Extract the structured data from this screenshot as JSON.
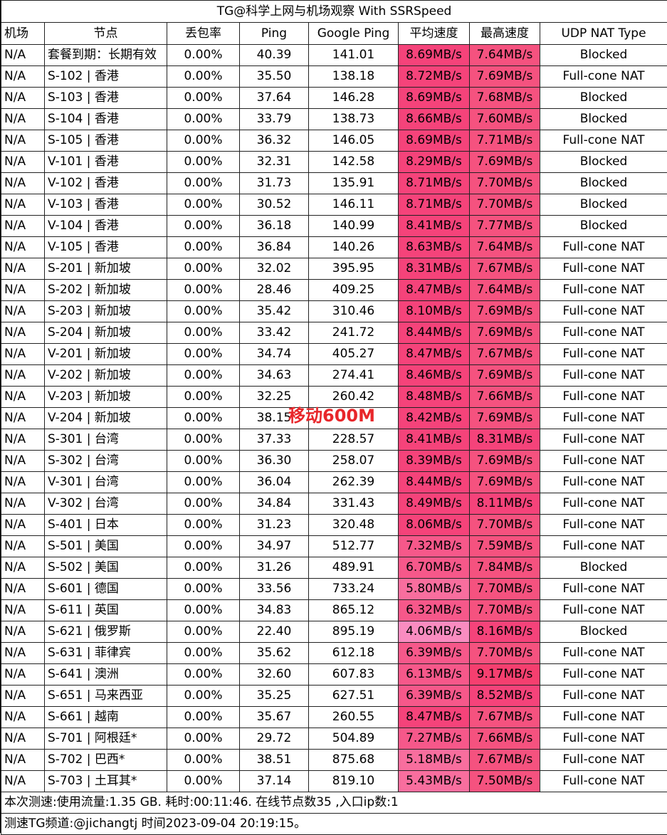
{
  "title": "TG@科学上网与机场观察 With SSRSpeed",
  "headers": [
    "机场",
    "节点",
    "丢包率",
    "Ping",
    "Google Ping",
    "平均速度",
    "最高速度",
    "UDP NAT Type"
  ],
  "colors": {
    "avg_speed_strong": "#f5437a",
    "avg_speed_mid": "#f6588a",
    "avg_speed_light": "#f98cc0",
    "max_speed_strong": "#f5437a",
    "max_speed_normal": "#f5527f",
    "border": "#222222",
    "watermark": "#e8262a"
  },
  "rows": [
    {
      "airport": "N/A",
      "node": "套餐到期：长期有效",
      "loss": "0.00%",
      "ping": "40.39",
      "gping": "141.01",
      "avg": "8.69MB/s",
      "max": "7.64MB/s",
      "nat": "Blocked",
      "avg_c": "#f5437a",
      "max_c": "#f5527f"
    },
    {
      "airport": "N/A",
      "node": "S-102 | 香港",
      "loss": "0.00%",
      "ping": "35.50",
      "gping": "138.18",
      "avg": "8.72MB/s",
      "max": "7.69MB/s",
      "nat": "Full-cone NAT",
      "avg_c": "#f5437a",
      "max_c": "#f5527f"
    },
    {
      "airport": "N/A",
      "node": "S-103 | 香港",
      "loss": "0.00%",
      "ping": "37.64",
      "gping": "146.28",
      "avg": "8.69MB/s",
      "max": "7.68MB/s",
      "nat": "Blocked",
      "avg_c": "#f5437a",
      "max_c": "#f5527f"
    },
    {
      "airport": "N/A",
      "node": "S-104 | 香港",
      "loss": "0.00%",
      "ping": "33.79",
      "gping": "138.73",
      "avg": "8.66MB/s",
      "max": "7.60MB/s",
      "nat": "Blocked",
      "avg_c": "#f5437a",
      "max_c": "#f5527f"
    },
    {
      "airport": "N/A",
      "node": "S-105 | 香港",
      "loss": "0.00%",
      "ping": "36.32",
      "gping": "146.05",
      "avg": "8.69MB/s",
      "max": "7.71MB/s",
      "nat": "Full-cone NAT",
      "avg_c": "#f5437a",
      "max_c": "#f5527f"
    },
    {
      "airport": "N/A",
      "node": "V-101 | 香港",
      "loss": "0.00%",
      "ping": "32.31",
      "gping": "142.58",
      "avg": "8.29MB/s",
      "max": "7.69MB/s",
      "nat": "Blocked",
      "avg_c": "#f5437a",
      "max_c": "#f5527f"
    },
    {
      "airport": "N/A",
      "node": "V-102 | 香港",
      "loss": "0.00%",
      "ping": "31.73",
      "gping": "135.91",
      "avg": "8.71MB/s",
      "max": "7.70MB/s",
      "nat": "Blocked",
      "avg_c": "#f5437a",
      "max_c": "#f5527f"
    },
    {
      "airport": "N/A",
      "node": "V-103 | 香港",
      "loss": "0.00%",
      "ping": "30.52",
      "gping": "146.11",
      "avg": "8.71MB/s",
      "max": "7.70MB/s",
      "nat": "Blocked",
      "avg_c": "#f5437a",
      "max_c": "#f5527f"
    },
    {
      "airport": "N/A",
      "node": "V-104 | 香港",
      "loss": "0.00%",
      "ping": "36.18",
      "gping": "140.99",
      "avg": "8.41MB/s",
      "max": "7.77MB/s",
      "nat": "Blocked",
      "avg_c": "#f5437a",
      "max_c": "#f5527f"
    },
    {
      "airport": "N/A",
      "node": "V-105 | 香港",
      "loss": "0.00%",
      "ping": "36.84",
      "gping": "140.26",
      "avg": "8.63MB/s",
      "max": "7.64MB/s",
      "nat": "Full-cone NAT",
      "avg_c": "#f5437a",
      "max_c": "#f5527f"
    },
    {
      "airport": "N/A",
      "node": "S-201 | 新加坡",
      "loss": "0.00%",
      "ping": "32.02",
      "gping": "395.95",
      "avg": "8.31MB/s",
      "max": "7.67MB/s",
      "nat": "Full-cone NAT",
      "avg_c": "#f5437a",
      "max_c": "#f5527f"
    },
    {
      "airport": "N/A",
      "node": "S-202 | 新加坡",
      "loss": "0.00%",
      "ping": "28.46",
      "gping": "409.25",
      "avg": "8.47MB/s",
      "max": "7.64MB/s",
      "nat": "Full-cone NAT",
      "avg_c": "#f5437a",
      "max_c": "#f5527f"
    },
    {
      "airport": "N/A",
      "node": "S-203 | 新加坡",
      "loss": "0.00%",
      "ping": "35.42",
      "gping": "310.46",
      "avg": "8.10MB/s",
      "max": "7.69MB/s",
      "nat": "Full-cone NAT",
      "avg_c": "#f5437a",
      "max_c": "#f5527f"
    },
    {
      "airport": "N/A",
      "node": "S-204 | 新加坡",
      "loss": "0.00%",
      "ping": "33.42",
      "gping": "241.72",
      "avg": "8.44MB/s",
      "max": "7.69MB/s",
      "nat": "Full-cone NAT",
      "avg_c": "#f5437a",
      "max_c": "#f5527f"
    },
    {
      "airport": "N/A",
      "node": "V-201 | 新加坡",
      "loss": "0.00%",
      "ping": "34.74",
      "gping": "405.27",
      "avg": "8.47MB/s",
      "max": "7.67MB/s",
      "nat": "Full-cone NAT",
      "avg_c": "#f5437a",
      "max_c": "#f5527f"
    },
    {
      "airport": "N/A",
      "node": "V-202 | 新加坡",
      "loss": "0.00%",
      "ping": "34.63",
      "gping": "274.41",
      "avg": "8.46MB/s",
      "max": "7.69MB/s",
      "nat": "Full-cone NAT",
      "avg_c": "#f5437a",
      "max_c": "#f5527f"
    },
    {
      "airport": "N/A",
      "node": "V-203 | 新加坡",
      "loss": "0.00%",
      "ping": "32.25",
      "gping": "260.42",
      "avg": "8.48MB/s",
      "max": "7.66MB/s",
      "nat": "Full-cone NAT",
      "avg_c": "#f5437a",
      "max_c": "#f5527f"
    },
    {
      "airport": "N/A",
      "node": "V-204 | 新加坡",
      "loss": "0.00%",
      "ping": "38.15",
      "gping": "",
      "avg": "8.42MB/s",
      "max": "7.69MB/s",
      "nat": "Full-cone NAT",
      "avg_c": "#f5437a",
      "max_c": "#f5527f"
    },
    {
      "airport": "N/A",
      "node": "S-301 | 台湾",
      "loss": "0.00%",
      "ping": "37.33",
      "gping": "228.57",
      "avg": "8.41MB/s",
      "max": "8.31MB/s",
      "nat": "Full-cone NAT",
      "avg_c": "#f5437a",
      "max_c": "#f5437a"
    },
    {
      "airport": "N/A",
      "node": "S-302 | 台湾",
      "loss": "0.00%",
      "ping": "36.30",
      "gping": "258.07",
      "avg": "8.39MB/s",
      "max": "7.69MB/s",
      "nat": "Full-cone NAT",
      "avg_c": "#f5437a",
      "max_c": "#f5527f"
    },
    {
      "airport": "N/A",
      "node": "V-301 | 台湾",
      "loss": "0.00%",
      "ping": "36.04",
      "gping": "262.39",
      "avg": "8.44MB/s",
      "max": "7.69MB/s",
      "nat": "Full-cone NAT",
      "avg_c": "#f5437a",
      "max_c": "#f5527f"
    },
    {
      "airport": "N/A",
      "node": "V-302 | 台湾",
      "loss": "0.00%",
      "ping": "34.84",
      "gping": "331.43",
      "avg": "8.49MB/s",
      "max": "8.11MB/s",
      "nat": "Full-cone NAT",
      "avg_c": "#f5437a",
      "max_c": "#f5437a"
    },
    {
      "airport": "N/A",
      "node": "S-401 | 日本",
      "loss": "0.00%",
      "ping": "31.23",
      "gping": "320.48",
      "avg": "8.06MB/s",
      "max": "7.70MB/s",
      "nat": "Full-cone NAT",
      "avg_c": "#f5437a",
      "max_c": "#f5527f"
    },
    {
      "airport": "N/A",
      "node": "S-501 | 美国",
      "loss": "0.00%",
      "ping": "34.97",
      "gping": "512.77",
      "avg": "7.32MB/s",
      "max": "7.59MB/s",
      "nat": "Full-cone NAT",
      "avg_c": "#f6588a",
      "max_c": "#f5527f"
    },
    {
      "airport": "N/A",
      "node": "S-502 | 美国",
      "loss": "0.00%",
      "ping": "31.26",
      "gping": "489.91",
      "avg": "6.70MB/s",
      "max": "7.84MB/s",
      "nat": "Blocked",
      "avg_c": "#f6588a",
      "max_c": "#f5527f"
    },
    {
      "airport": "N/A",
      "node": "S-601 | 德国",
      "loss": "0.00%",
      "ping": "33.56",
      "gping": "733.24",
      "avg": "5.80MB/s",
      "max": "7.70MB/s",
      "nat": "Full-cone NAT",
      "avg_c": "#f86e9e",
      "max_c": "#f5527f"
    },
    {
      "airport": "N/A",
      "node": "S-611 | 英国",
      "loss": "0.00%",
      "ping": "34.83",
      "gping": "865.12",
      "avg": "6.32MB/s",
      "max": "7.70MB/s",
      "nat": "Full-cone NAT",
      "avg_c": "#f6588a",
      "max_c": "#f5527f"
    },
    {
      "airport": "N/A",
      "node": "S-621 | 俄罗斯",
      "loss": "0.00%",
      "ping": "22.40",
      "gping": "895.19",
      "avg": "4.06MB/s",
      "max": "8.16MB/s",
      "nat": "Blocked",
      "avg_c": "#f98cc0",
      "max_c": "#f5437a"
    },
    {
      "airport": "N/A",
      "node": "S-631 | 菲律宾",
      "loss": "0.00%",
      "ping": "35.62",
      "gping": "612.18",
      "avg": "6.39MB/s",
      "max": "7.70MB/s",
      "nat": "Full-cone NAT",
      "avg_c": "#f6588a",
      "max_c": "#f5527f"
    },
    {
      "airport": "N/A",
      "node": "S-641 | 澳洲",
      "loss": "0.00%",
      "ping": "32.60",
      "gping": "607.83",
      "avg": "6.13MB/s",
      "max": "9.17MB/s",
      "nat": "Full-cone NAT",
      "avg_c": "#f6588a",
      "max_c": "#f53f6f"
    },
    {
      "airport": "N/A",
      "node": "S-651 | 马来西亚",
      "loss": "0.00%",
      "ping": "35.25",
      "gping": "627.51",
      "avg": "6.39MB/s",
      "max": "8.52MB/s",
      "nat": "Full-cone NAT",
      "avg_c": "#f6588a",
      "max_c": "#f5437a"
    },
    {
      "airport": "N/A",
      "node": "S-661 | 越南",
      "loss": "0.00%",
      "ping": "35.67",
      "gping": "260.55",
      "avg": "8.47MB/s",
      "max": "7.67MB/s",
      "nat": "Full-cone NAT",
      "avg_c": "#f5437a",
      "max_c": "#f5527f"
    },
    {
      "airport": "N/A",
      "node": "S-701 | 阿根廷*",
      "loss": "0.00%",
      "ping": "29.72",
      "gping": "504.89",
      "avg": "7.27MB/s",
      "max": "7.66MB/s",
      "nat": "Full-cone NAT",
      "avg_c": "#f6588a",
      "max_c": "#f5527f"
    },
    {
      "airport": "N/A",
      "node": "S-702 | 巴西*",
      "loss": "0.00%",
      "ping": "38.51",
      "gping": "875.68",
      "avg": "5.18MB/s",
      "max": "7.67MB/s",
      "nat": "Full-cone NAT",
      "avg_c": "#f86e9e",
      "max_c": "#f5527f"
    },
    {
      "airport": "N/A",
      "node": "S-703 | 土耳其*",
      "loss": "0.00%",
      "ping": "37.14",
      "gping": "819.10",
      "avg": "5.43MB/s",
      "max": "7.50MB/s",
      "nat": "Full-cone NAT",
      "avg_c": "#f86e9e",
      "max_c": "#f5527f"
    }
  ],
  "watermark": "移动600M",
  "footer": {
    "line1": "本次测速:使用流量:1.35 GB. 耗时:00:11:46. 在线节点数35 ,入口ip数:1",
    "line2": "测速TG频道:@jichangtj 时间2023-09-04 20:19:15。"
  }
}
